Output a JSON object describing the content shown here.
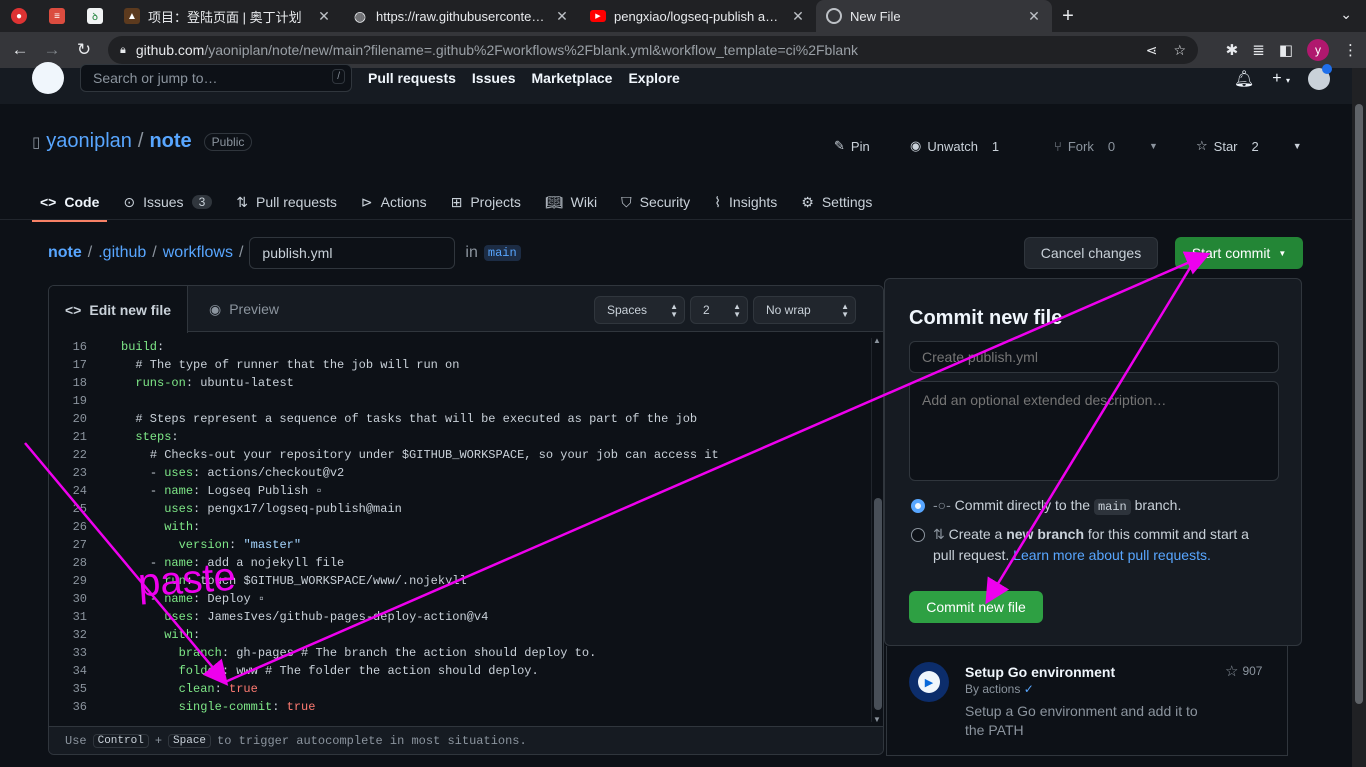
{
  "browser": {
    "tabs": [
      {
        "title": "",
        "icon": "tomato-icon",
        "color": "#d33"
      },
      {
        "title": "",
        "icon": "todoist-icon",
        "color": "#db4c3f"
      },
      {
        "title": "",
        "icon": "app-icon",
        "color": "#e8eaed"
      },
      {
        "title": "项目：登陆页面 | 奥丁计划",
        "icon": "odin-icon",
        "color": "#c58b49"
      },
      {
        "title": "https://raw.githubusercontent.com",
        "icon": "globe-icon",
        "color": "#e8eaed"
      },
      {
        "title": "pengxiao/logseq-publish action",
        "icon": "youtube-icon",
        "color": "#f00"
      },
      {
        "title": "New File",
        "icon": "github-icon",
        "color": "#e8eaed"
      }
    ],
    "url_host": "github.com",
    "url_path": "/yaoniplan/note/new/main?filename=.github%2Fworkflows%2Fblank.yml&workflow_template=ci%2Fblank",
    "profile_initial": "y"
  },
  "github_header": {
    "search_placeholder": "Search or jump to…",
    "search_shortcut": "/",
    "nav": [
      "Pull requests",
      "Issues",
      "Marketplace",
      "Explore"
    ]
  },
  "repo": {
    "owner": "yaoniplan",
    "name": "note",
    "visibility": "Public",
    "pin_label": "Pin",
    "watch_label": "Unwatch",
    "watch_count": "1",
    "fork_label": "Fork",
    "fork_count": "0",
    "star_label": "Star",
    "star_count": "2",
    "tabs": [
      {
        "label": "Code",
        "icon": "code-icon"
      },
      {
        "label": "Issues",
        "icon": "issue-icon",
        "count": "3"
      },
      {
        "label": "Pull requests",
        "icon": "pull-request-icon"
      },
      {
        "label": "Actions",
        "icon": "play-icon"
      },
      {
        "label": "Projects",
        "icon": "table-icon"
      },
      {
        "label": "Wiki",
        "icon": "book-icon"
      },
      {
        "label": "Security",
        "icon": "shield-icon"
      },
      {
        "label": "Insights",
        "icon": "graph-icon"
      },
      {
        "label": "Settings",
        "icon": "gear-icon"
      }
    ]
  },
  "breadcrumb": {
    "root": "note",
    "dir1": ".github",
    "dir2": "workflows",
    "filename": "publish.yml",
    "in_word": "in",
    "branch": "main"
  },
  "buttons": {
    "cancel": "Cancel changes",
    "start_commit": "Start commit",
    "commit_new_file": "Commit new file"
  },
  "editor": {
    "edit_tab": "Edit new file",
    "preview_tab": "Preview",
    "indent_mode": "Spaces",
    "indent_size": "2",
    "wrap_mode": "No wrap",
    "footer_use": "Use",
    "footer_key1": "Control",
    "footer_plus": "+",
    "footer_key2": "Space",
    "footer_text": "to trigger autocomplete in most situations.",
    "lines": [
      {
        "n": "16",
        "indent": "",
        "key": "build",
        "rest": ":"
      },
      {
        "n": "17",
        "indent": "  ",
        "comment": "# The type of runner that the job will run on"
      },
      {
        "n": "18",
        "indent": "  ",
        "key": "runs-on",
        "rest": ": ubuntu-latest"
      },
      {
        "n": "19",
        "indent": ""
      },
      {
        "n": "20",
        "indent": "  ",
        "comment": "# Steps represent a sequence of tasks that will be executed as part of the job"
      },
      {
        "n": "21",
        "indent": "  ",
        "key": "steps",
        "rest": ":"
      },
      {
        "n": "22",
        "indent": "    ",
        "comment": "# Checks-out your repository under $GITHUB_WORKSPACE, so your job can access it"
      },
      {
        "n": "23",
        "indent": "    ",
        "dash": "- ",
        "key": "uses",
        "rest": ": actions/checkout@v2"
      },
      {
        "n": "24",
        "indent": "    ",
        "dash": "- ",
        "key": "name",
        "rest": ": Logseq Publish ▫"
      },
      {
        "n": "25",
        "indent": "      ",
        "key": "uses",
        "rest": ": pengx17/logseq-publish@main"
      },
      {
        "n": "26",
        "indent": "      ",
        "key": "with",
        "rest": ":"
      },
      {
        "n": "27",
        "indent": "        ",
        "key": "version",
        "rest": ": ",
        "str": "\"master\""
      },
      {
        "n": "28",
        "indent": "    ",
        "dash": "- ",
        "key": "name",
        "rest": ": add a nojekyll file"
      },
      {
        "n": "29",
        "indent": "      ",
        "key": "run",
        "rest": ": touch $GITHUB_WORKSPACE/www/.nojekyll"
      },
      {
        "n": "30",
        "indent": "    ",
        "dash": "- ",
        "key": "name",
        "rest": ": Deploy ▫"
      },
      {
        "n": "31",
        "indent": "      ",
        "key": "uses",
        "rest": ": JamesIves/github-pages-deploy-action@v4"
      },
      {
        "n": "32",
        "indent": "      ",
        "key": "with",
        "rest": ":"
      },
      {
        "n": "33",
        "indent": "        ",
        "key": "branch",
        "rest": ": gh-pages # The branch the action should deploy to."
      },
      {
        "n": "34",
        "indent": "        ",
        "key": "folder",
        "rest": ": www # The folder the action should deploy."
      },
      {
        "n": "35",
        "indent": "        ",
        "key": "clean",
        "rest": ": ",
        "bool": "true"
      },
      {
        "n": "36",
        "indent": "        ",
        "key": "single-commit",
        "rest": ": ",
        "bool": "true"
      }
    ]
  },
  "commit_panel": {
    "title": "Commit new file",
    "summary_placeholder": "Create publish.yml",
    "description_placeholder": "Add an optional extended description…",
    "option_direct_pre": "Commit directly to the",
    "option_direct_branch": "main",
    "option_direct_post": "branch.",
    "option_new_pre": "Create a",
    "option_new_bold": "new branch",
    "option_new_mid": "for this commit and start a",
    "option_new_tail": "pull request.",
    "option_new_link": "Learn more about pull requests."
  },
  "suggestion_card": {
    "title": "Setup Go environment",
    "by": "By actions",
    "description": "Setup a Go environment and add it to the PATH",
    "stars": "907"
  },
  "annotation": {
    "text": "paste",
    "color": "#ee00ee"
  }
}
